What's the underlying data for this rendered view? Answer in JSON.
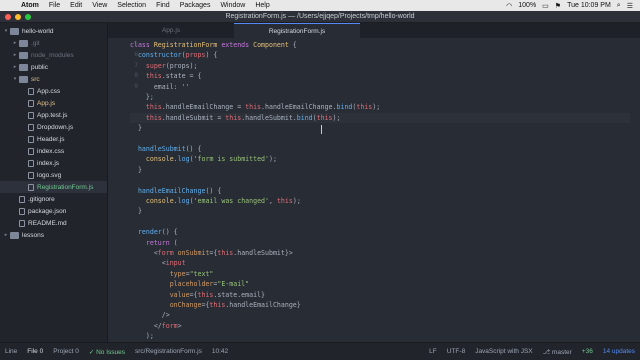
{
  "menubar": {
    "app": "Atom",
    "items": [
      "File",
      "Edit",
      "View",
      "Selection",
      "Find",
      "Packages",
      "Window",
      "Help"
    ],
    "battery": "100%",
    "clock": "Tue 10:09 PM"
  },
  "window": {
    "title": "RegistrationForm.js — /Users/ejjqep/Projects/tmp/hello-world"
  },
  "tree": [
    {
      "label": "hello-world",
      "depth": 0,
      "kind": "folder",
      "arrow": "▾",
      "style": "normal"
    },
    {
      "label": ".git",
      "depth": 1,
      "kind": "folder",
      "arrow": "▸",
      "style": "dim"
    },
    {
      "label": "node_modules",
      "depth": 1,
      "kind": "folder",
      "arrow": "▸",
      "style": "dim"
    },
    {
      "label": "public",
      "depth": 1,
      "kind": "folder",
      "arrow": "▸",
      "style": "normal"
    },
    {
      "label": "src",
      "depth": 1,
      "kind": "folder",
      "arrow": "▾",
      "style": "orange"
    },
    {
      "label": "App.css",
      "depth": 2,
      "kind": "file",
      "arrow": "",
      "style": "normal"
    },
    {
      "label": "App.js",
      "depth": 2,
      "kind": "file",
      "arrow": "",
      "style": "orange"
    },
    {
      "label": "App.test.js",
      "depth": 2,
      "kind": "file",
      "arrow": "",
      "style": "normal"
    },
    {
      "label": "Dropdown.js",
      "depth": 2,
      "kind": "file",
      "arrow": "",
      "style": "normal"
    },
    {
      "label": "Header.js",
      "depth": 2,
      "kind": "file",
      "arrow": "",
      "style": "normal"
    },
    {
      "label": "index.css",
      "depth": 2,
      "kind": "file",
      "arrow": "",
      "style": "normal"
    },
    {
      "label": "index.js",
      "depth": 2,
      "kind": "file",
      "arrow": "",
      "style": "normal"
    },
    {
      "label": "logo.svg",
      "depth": 2,
      "kind": "file",
      "arrow": "",
      "style": "normal"
    },
    {
      "label": "RegistrationForm.js",
      "depth": 2,
      "kind": "file",
      "arrow": "",
      "style": "green",
      "selected": true
    },
    {
      "label": ".gitignore",
      "depth": 1,
      "kind": "file",
      "arrow": "",
      "style": "normal"
    },
    {
      "label": "package.json",
      "depth": 1,
      "kind": "file",
      "arrow": "",
      "style": "normal"
    },
    {
      "label": "README.md",
      "depth": 1,
      "kind": "file",
      "arrow": "",
      "style": "normal"
    },
    {
      "label": "lessons",
      "depth": 0,
      "kind": "folder",
      "arrow": "▸",
      "style": "normal"
    }
  ],
  "tabs": [
    {
      "label": "App.js",
      "active": false
    },
    {
      "label": "RegistrationForm.js",
      "active": true
    }
  ],
  "editor": {
    "current_line": 10,
    "lines": [
      {
        "n": "5",
        "segs": [
          [
            "class ",
            "#c678dd"
          ],
          [
            "RegistrationForm ",
            "#e5c07b"
          ],
          [
            "extends ",
            "#c678dd"
          ],
          [
            "Component",
            "#e5c07b"
          ],
          [
            " {",
            "#abb2bf"
          ]
        ]
      },
      {
        "n": "6",
        "segs": [
          [
            "  constructor",
            "#61afef"
          ],
          [
            "(",
            "#abb2bf"
          ],
          [
            "props",
            "#e06c75"
          ],
          [
            ") {",
            "#abb2bf"
          ]
        ]
      },
      {
        "n": "7",
        "segs": [
          [
            "    super",
            "#e06c75"
          ],
          [
            "(props);",
            "#abb2bf"
          ]
        ]
      },
      {
        "n": "8",
        "segs": [
          [
            "    this",
            "#e06c75"
          ],
          [
            ".state = {",
            "#abb2bf"
          ]
        ]
      },
      {
        "n": "9",
        "segs": [
          [
            "      email: ",
            "#abb2bf"
          ],
          [
            "''",
            "#98c379"
          ]
        ]
      },
      {
        "n": "",
        "segs": [
          [
            "    };",
            "#abb2bf"
          ]
        ]
      },
      {
        "n": "",
        "segs": [
          [
            "    this",
            "#e06c75"
          ],
          [
            ".handleEmailChange = ",
            "#abb2bf"
          ],
          [
            "this",
            "#e06c75"
          ],
          [
            ".handleEmailChange.",
            "#abb2bf"
          ],
          [
            "bind",
            "#61afef"
          ],
          [
            "(",
            "#abb2bf"
          ],
          [
            "this",
            "#e06c75"
          ],
          [
            ");",
            "#abb2bf"
          ]
        ]
      },
      {
        "n": "10",
        "segs": [
          [
            "    this",
            "#e06c75"
          ],
          [
            ".handleSubmit = ",
            "#abb2bf"
          ],
          [
            "this",
            "#e06c75"
          ],
          [
            ".handleSubmit.",
            "#abb2bf"
          ],
          [
            "bind",
            "#61afef"
          ],
          [
            "(",
            "#abb2bf"
          ],
          [
            "this",
            "#e06c75"
          ],
          [
            ");",
            "#abb2bf"
          ]
        ]
      },
      {
        "n": "",
        "segs": [
          [
            "  }",
            "#abb2bf"
          ]
        ]
      },
      {
        "n": "",
        "segs": []
      },
      {
        "n": "",
        "segs": [
          [
            "  handleSubmit",
            "#61afef"
          ],
          [
            "() {",
            "#abb2bf"
          ]
        ]
      },
      {
        "n": "",
        "segs": [
          [
            "    console",
            "#e5c07b"
          ],
          [
            ".",
            "#abb2bf"
          ],
          [
            "log",
            "#61afef"
          ],
          [
            "(",
            "#abb2bf"
          ],
          [
            "'form is submitted'",
            "#98c379"
          ],
          [
            ");",
            "#abb2bf"
          ]
        ]
      },
      {
        "n": "",
        "segs": [
          [
            "  }",
            "#abb2bf"
          ]
        ]
      },
      {
        "n": "",
        "segs": []
      },
      {
        "n": "",
        "segs": [
          [
            "  handleEmailChange",
            "#61afef"
          ],
          [
            "() {",
            "#abb2bf"
          ]
        ]
      },
      {
        "n": "",
        "segs": [
          [
            "    console",
            "#e5c07b"
          ],
          [
            ".",
            "#abb2bf"
          ],
          [
            "log",
            "#61afef"
          ],
          [
            "(",
            "#abb2bf"
          ],
          [
            "'email was changed'",
            "#98c379"
          ],
          [
            ", ",
            "#abb2bf"
          ],
          [
            "this",
            "#e06c75"
          ],
          [
            ");",
            "#abb2bf"
          ]
        ]
      },
      {
        "n": "",
        "segs": [
          [
            "  }",
            "#abb2bf"
          ]
        ]
      },
      {
        "n": "",
        "segs": []
      },
      {
        "n": "",
        "segs": [
          [
            "  render",
            "#61afef"
          ],
          [
            "() {",
            "#abb2bf"
          ]
        ]
      },
      {
        "n": "",
        "segs": [
          [
            "    return",
            "#c678dd"
          ],
          [
            " (",
            "#abb2bf"
          ]
        ]
      },
      {
        "n": "",
        "segs": [
          [
            "      <",
            "#abb2bf"
          ],
          [
            "form ",
            "#e06c75"
          ],
          [
            "onSubmit",
            "#d19a66"
          ],
          [
            "={",
            "#abb2bf"
          ],
          [
            "this",
            "#e06c75"
          ],
          [
            ".handleSubmit}>",
            "#abb2bf"
          ]
        ]
      },
      {
        "n": "",
        "segs": [
          [
            "        <",
            "#abb2bf"
          ],
          [
            "input",
            "#e06c75"
          ]
        ]
      },
      {
        "n": "",
        "segs": [
          [
            "          type",
            "#d19a66"
          ],
          [
            "=",
            "#abb2bf"
          ],
          [
            "\"text\"",
            "#98c379"
          ]
        ]
      },
      {
        "n": "",
        "segs": [
          [
            "          placeholder",
            "#d19a66"
          ],
          [
            "=",
            "#abb2bf"
          ],
          [
            "\"E-mail\"",
            "#98c379"
          ]
        ]
      },
      {
        "n": "",
        "segs": [
          [
            "          value",
            "#d19a66"
          ],
          [
            "={",
            "#abb2bf"
          ],
          [
            "this",
            "#e06c75"
          ],
          [
            ".state.email}",
            "#abb2bf"
          ]
        ]
      },
      {
        "n": "",
        "segs": [
          [
            "          onChange",
            "#d19a66"
          ],
          [
            "={",
            "#abb2bf"
          ],
          [
            "this",
            "#e06c75"
          ],
          [
            ".handleEmailChange}",
            "#abb2bf"
          ]
        ]
      },
      {
        "n": "",
        "segs": [
          [
            "        />",
            "#abb2bf"
          ]
        ]
      },
      {
        "n": "",
        "segs": [
          [
            "      </",
            "#abb2bf"
          ],
          [
            "form",
            "#e06c75"
          ],
          [
            ">",
            "#abb2bf"
          ]
        ]
      },
      {
        "n": "",
        "segs": [
          [
            "    );",
            "#abb2bf"
          ]
        ]
      }
    ]
  },
  "statusbar": {
    "left": [
      {
        "label": "Line",
        "style": "normal"
      },
      {
        "label": "File 0",
        "style": "active"
      },
      {
        "label": "Project 0",
        "style": "normal"
      },
      {
        "label": "✓ No Issues",
        "style": "green"
      },
      {
        "label": "src/RegistrationForm.js",
        "style": "normal"
      },
      {
        "label": "10:42",
        "style": "normal"
      }
    ],
    "right": [
      {
        "label": "LF",
        "style": "normal"
      },
      {
        "label": "UTF-8",
        "style": "normal"
      },
      {
        "label": "JavaScript with JSX",
        "style": "normal"
      },
      {
        "label": "⎇ master",
        "style": "normal"
      },
      {
        "label": "+36",
        "style": "green"
      },
      {
        "label": "14 updates",
        "style": "blue"
      }
    ]
  }
}
